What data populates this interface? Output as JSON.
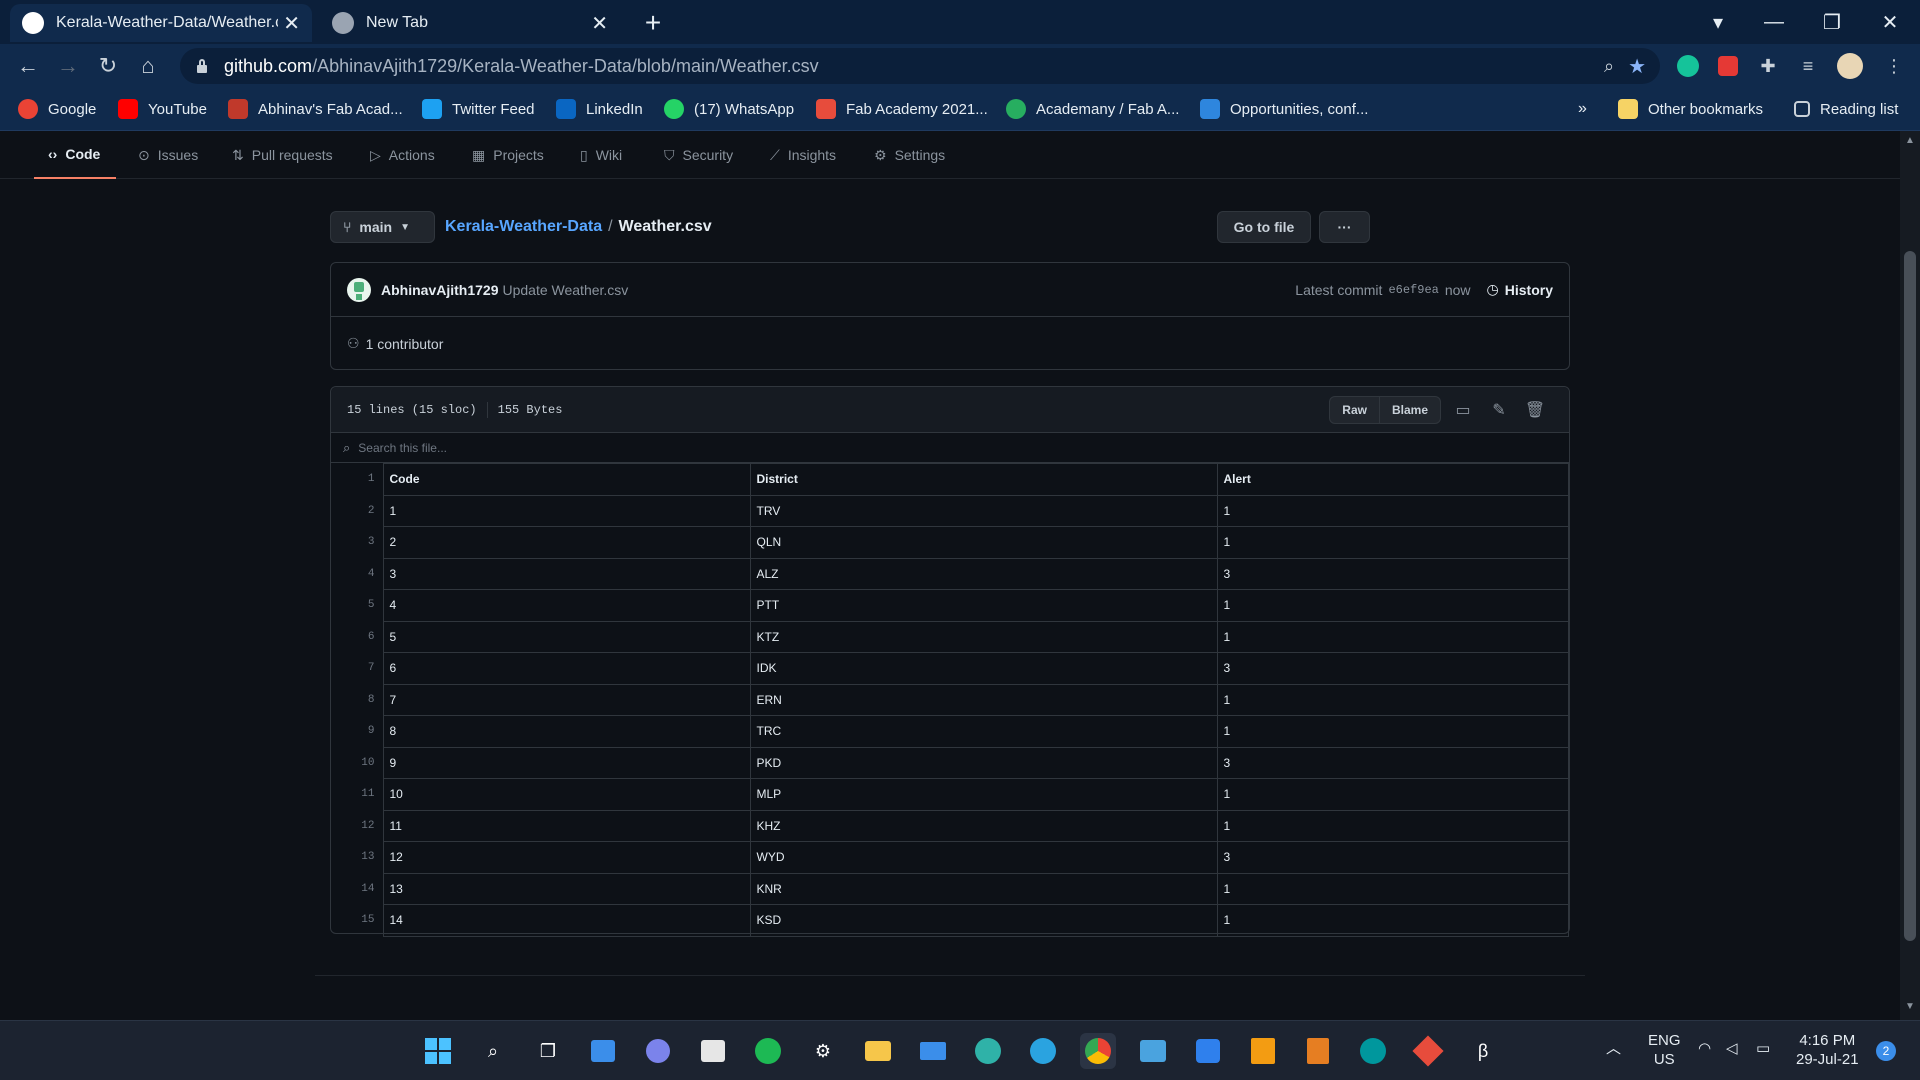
{
  "browser": {
    "tabs": [
      {
        "title": "Kerala-Weather-Data/Weather.csv",
        "active": true
      },
      {
        "title": "New Tab",
        "active": false
      }
    ],
    "url_host": "github.com",
    "url_path": "/AbhinavAjith1729/Kerala-Weather-Data/blob/main/Weather.csv",
    "bookmarks": [
      {
        "label": "Google",
        "color": "#ea4335"
      },
      {
        "label": "YouTube",
        "color": "#ff0000"
      },
      {
        "label": "Abhinav's Fab Acad...",
        "color": "#c0392b"
      },
      {
        "label": "Twitter Feed",
        "color": "#1da1f2"
      },
      {
        "label": "LinkedIn",
        "color": "#0a66c2"
      },
      {
        "label": "(17) WhatsApp",
        "color": "#25d366"
      },
      {
        "label": "Fab Academy 2021...",
        "color": "#e74c3c"
      },
      {
        "label": "Academany / Fab A...",
        "color": "#27ae60"
      },
      {
        "label": "Opportunities, conf...",
        "color": "#2e86de"
      }
    ],
    "overflow": "»",
    "other_bookmarks": "Other bookmarks",
    "reading_list": "Reading list"
  },
  "repo_nav": {
    "tabs": [
      {
        "label": "Code",
        "glyph": "‹›",
        "active": true
      },
      {
        "label": "Issues",
        "glyph": "⊙"
      },
      {
        "label": "Pull requests",
        "glyph": "⇅"
      },
      {
        "label": "Actions",
        "glyph": "▷"
      },
      {
        "label": "Projects",
        "glyph": "▦"
      },
      {
        "label": "Wiki",
        "glyph": "▯"
      },
      {
        "label": "Security",
        "glyph": "⛉"
      },
      {
        "label": "Insights",
        "glyph": "⟋"
      },
      {
        "label": "Settings",
        "glyph": "⚙"
      }
    ]
  },
  "file": {
    "branch": "main",
    "repo": "Kerala-Weather-Data",
    "sep": "/",
    "name": "Weather.csv",
    "go_to_file": "Go to file",
    "more": "···",
    "commit_author": "AbhinavAjith1729",
    "commit_message": "Update Weather.csv",
    "latest_commit_label": "Latest commit",
    "sha": "e6ef9ea",
    "when": "now",
    "history": "History",
    "contributors": "1 contributor",
    "lines": "15 lines (15 sloc)",
    "size": "155 Bytes",
    "raw": "Raw",
    "blame": "Blame",
    "search_placeholder": "Search this file..."
  },
  "table": {
    "headers": [
      "Code",
      "District",
      "Alert"
    ],
    "rows": [
      [
        "1",
        "TRV",
        "1"
      ],
      [
        "2",
        "QLN",
        "1"
      ],
      [
        "3",
        "ALZ",
        "3"
      ],
      [
        "4",
        "PTT",
        "1"
      ],
      [
        "5",
        "KTZ",
        "1"
      ],
      [
        "6",
        "IDK",
        "3"
      ],
      [
        "7",
        "ERN",
        "1"
      ],
      [
        "8",
        "TRC",
        "1"
      ],
      [
        "9",
        "PKD",
        "3"
      ],
      [
        "10",
        "MLP",
        "1"
      ],
      [
        "11",
        "KHZ",
        "1"
      ],
      [
        "12",
        "WYD",
        "3"
      ],
      [
        "13",
        "KNR",
        "1"
      ],
      [
        "14",
        "KSD",
        "1"
      ]
    ]
  },
  "taskbar": {
    "lang": "ENG",
    "region": "US",
    "time": "4:16 PM",
    "date": "29-Jul-21",
    "notifications": "2"
  }
}
